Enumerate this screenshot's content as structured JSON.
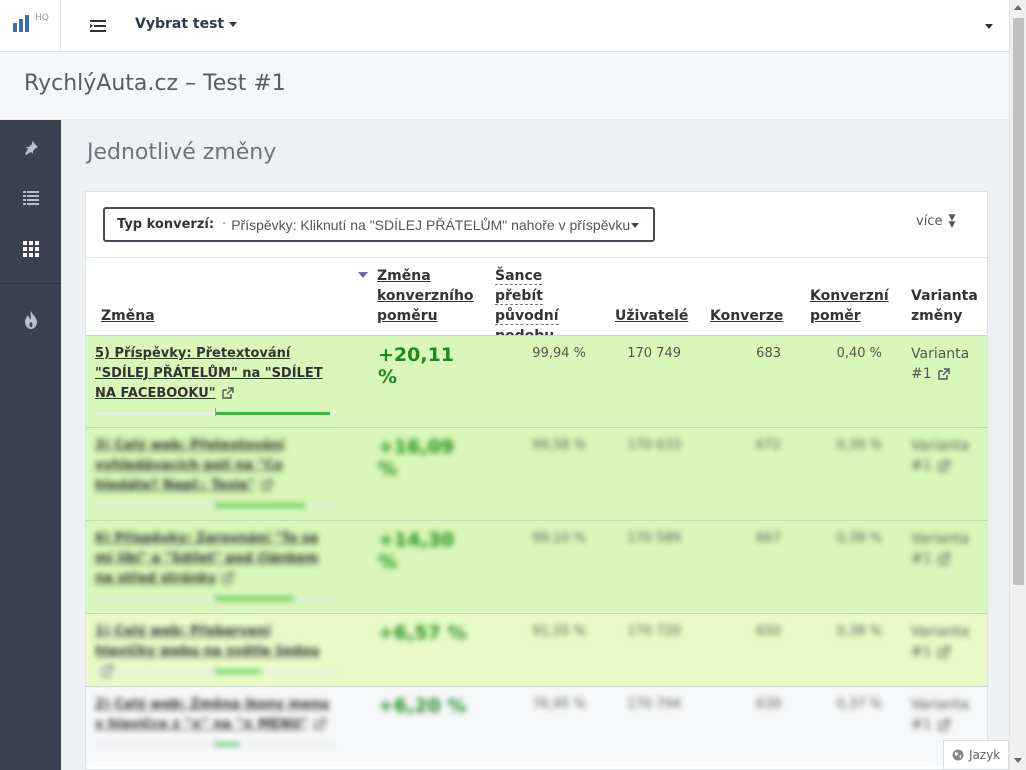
{
  "brand": {
    "logo_suffix": "HQ"
  },
  "header": {
    "test_select_label": "Vybrat test"
  },
  "page_title": "RychlýAuta.cz – Test #1",
  "sidebar": {
    "items": [
      {
        "icon": "pin-icon",
        "active": false
      },
      {
        "icon": "list-icon",
        "active": false
      },
      {
        "icon": "grid-icon",
        "active": true
      },
      {
        "icon": "fire-icon",
        "active": false
      }
    ]
  },
  "section": {
    "title": "Jednotlivé změny"
  },
  "conversion": {
    "label": "Typ konverzí:",
    "bullet": "·",
    "value": "Příspěvky: Kliknutí na \"SDÍLEJ PŘÁTELŮM\" nahoře v příspěvku"
  },
  "more_label": "více",
  "table": {
    "columns": [
      "Změna",
      "Změna konverzního poměru",
      "Šance přebít původní podobu",
      "Uživatelé",
      "Konverze",
      "Konverzní poměr",
      "Varianta změny"
    ],
    "rows": [
      {
        "name": "5) Příspěvky: Přetextování \"SDÍLEJ PŘÁTELŮM\" na \"SDÍLET NA FACEBOOKU\"",
        "change": "+20,11 %",
        "chance": "99,94 %",
        "users": "170 749",
        "conversions": "683",
        "ratio": "0,40 %",
        "variant": "Varianta #1",
        "bar_start": 0.5,
        "bar_end": 0.98,
        "bg": "#d9f7b8",
        "blurred": false
      },
      {
        "name": "3) Celý web: Přetextování vyhledávacích polí na \"Co hledáte? Např.: Tesla\"",
        "change": "+16,09 %",
        "chance": "99,58 %",
        "users": "170 633",
        "conversions": "672",
        "ratio": "0,39 %",
        "variant": "Varianta #1",
        "bar_start": 0.5,
        "bar_end": 0.88,
        "bg": "#d9f7b8",
        "blurred": true
      },
      {
        "name": "6) Příspěvky: Zarovnání \"To se mi líbí\" a \"Sdílet\" pod článkem na střed stránky",
        "change": "+14,30 %",
        "chance": "99,10 %",
        "users": "170 589",
        "conversions": "667",
        "ratio": "0,39 %",
        "variant": "Varianta #1",
        "bar_start": 0.5,
        "bar_end": 0.83,
        "bg": "#d9f7b8",
        "blurred": true
      },
      {
        "name": "1) Celý web: Přebarvení hlavičky webu na světle šedou",
        "change": "+6,57 %",
        "chance": "91,55 %",
        "users": "170 720",
        "conversions": "650",
        "ratio": "0,38 %",
        "variant": "Varianta #1",
        "bar_start": 0.5,
        "bar_end": 0.69,
        "bg": "#e8fbc6",
        "blurred": true
      },
      {
        "name": "2) Celý web: Změna ikony menu v hlavičce z \"≡\" na \"≡ MENU\"",
        "change": "+6,20 %",
        "chance": "76,95 %",
        "users": "170 794",
        "conversions": "639",
        "ratio": "0,37 %",
        "variant": "Varianta #1",
        "bar_start": 0.5,
        "bar_end": 0.6,
        "bg": "#f7f8f9",
        "blurred": true
      }
    ]
  },
  "language_label": "Jazyk",
  "colors": {
    "sidebar": "#3a4150",
    "positive": "#1d8a1d",
    "bar": "#2fbf3f",
    "row_green": "#d9f7b8",
    "sort_arrow": "#7a5fc0"
  }
}
